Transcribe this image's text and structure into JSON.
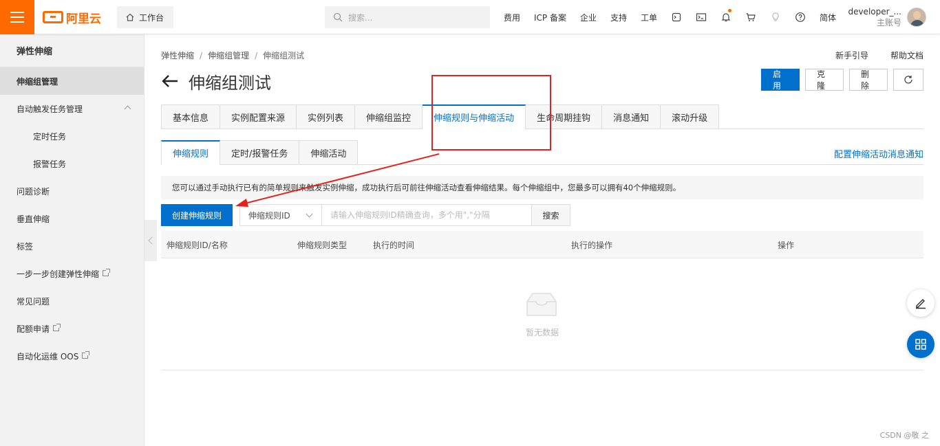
{
  "topbar": {
    "logo_text": "阿里云",
    "workbench": "工作台",
    "search_placeholder": "搜索...",
    "nav": [
      "费用",
      "ICP 备案",
      "企业",
      "支持",
      "工单"
    ],
    "lang": "简体",
    "user_name": "developer_...",
    "user_sub": "主账号",
    "icons": [
      "cloudshell-icon",
      "terminal-icon",
      "bell-icon",
      "cart-icon",
      "bulb-icon",
      "help-icon"
    ]
  },
  "sidebar": {
    "title": "弹性伸缩",
    "items": [
      {
        "label": "伸缩组管理"
      },
      {
        "label": "自动触发任务管理"
      },
      {
        "label": "定时任务"
      },
      {
        "label": "报警任务"
      },
      {
        "label": "问题诊断"
      },
      {
        "label": "垂直伸缩"
      },
      {
        "label": "标签"
      },
      {
        "label": "一步一步创建弹性伸缩"
      },
      {
        "label": "常见问题"
      },
      {
        "label": "配额申请"
      },
      {
        "label": "自动化运维 OOS"
      }
    ]
  },
  "breadcrumb": [
    "弹性伸缩",
    "伸缩组管理",
    "伸缩组测试"
  ],
  "help_links": [
    "新手引导",
    "帮助文档"
  ],
  "page_title": "伸缩组测试",
  "actions": {
    "enable": "启用",
    "clone": "克隆",
    "delete": "删除"
  },
  "tabs": [
    "基本信息",
    "实例配置来源",
    "实例列表",
    "伸缩组监控",
    "伸缩规则与伸缩活动",
    "生命周期挂钩",
    "消息通知",
    "滚动升级"
  ],
  "subtabs": [
    "伸缩规则",
    "定时/报警任务",
    "伸缩活动"
  ],
  "notify_link": "配置伸缩活动消息通知",
  "info": "您可以通过手动执行已有的简单规则来触发实例伸缩，成功执行后可前往伸缩活动查看伸缩结果。每个伸缩组中，您最多可以拥有40个伸缩规则。",
  "toolbar": {
    "create": "创建伸缩规则",
    "select_value": "伸缩规则ID",
    "query_placeholder": "请输入伸缩规则ID精确查询，多个用\",\"分隔",
    "search": "搜索"
  },
  "table": {
    "columns": [
      "伸缩规则ID/名称",
      "伸缩规则类型",
      "执行的时间",
      "执行的操作",
      "操作"
    ],
    "empty_text": "暂无数据"
  },
  "watermark": "CSDN @敬 之",
  "colors": {
    "brand": "#ff6a00",
    "primary": "#0070cc",
    "annotation": "#e4211e"
  }
}
